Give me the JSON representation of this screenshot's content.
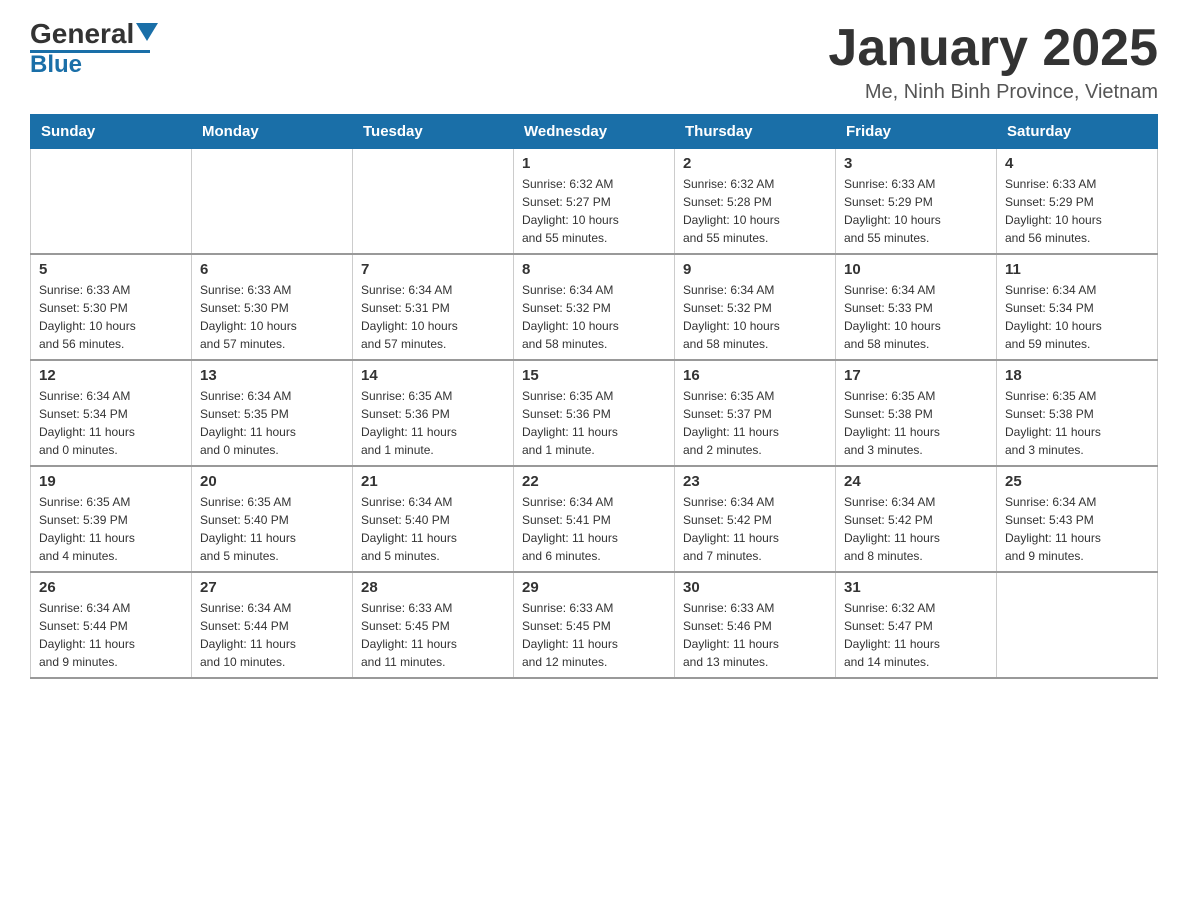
{
  "header": {
    "logo_general": "General",
    "logo_blue": "Blue",
    "title": "January 2025",
    "subtitle": "Me, Ninh Binh Province, Vietnam"
  },
  "days_of_week": [
    "Sunday",
    "Monday",
    "Tuesday",
    "Wednesday",
    "Thursday",
    "Friday",
    "Saturday"
  ],
  "weeks": [
    [
      {
        "day": "",
        "info": ""
      },
      {
        "day": "",
        "info": ""
      },
      {
        "day": "",
        "info": ""
      },
      {
        "day": "1",
        "info": "Sunrise: 6:32 AM\nSunset: 5:27 PM\nDaylight: 10 hours\nand 55 minutes."
      },
      {
        "day": "2",
        "info": "Sunrise: 6:32 AM\nSunset: 5:28 PM\nDaylight: 10 hours\nand 55 minutes."
      },
      {
        "day": "3",
        "info": "Sunrise: 6:33 AM\nSunset: 5:29 PM\nDaylight: 10 hours\nand 55 minutes."
      },
      {
        "day": "4",
        "info": "Sunrise: 6:33 AM\nSunset: 5:29 PM\nDaylight: 10 hours\nand 56 minutes."
      }
    ],
    [
      {
        "day": "5",
        "info": "Sunrise: 6:33 AM\nSunset: 5:30 PM\nDaylight: 10 hours\nand 56 minutes."
      },
      {
        "day": "6",
        "info": "Sunrise: 6:33 AM\nSunset: 5:30 PM\nDaylight: 10 hours\nand 57 minutes."
      },
      {
        "day": "7",
        "info": "Sunrise: 6:34 AM\nSunset: 5:31 PM\nDaylight: 10 hours\nand 57 minutes."
      },
      {
        "day": "8",
        "info": "Sunrise: 6:34 AM\nSunset: 5:32 PM\nDaylight: 10 hours\nand 58 minutes."
      },
      {
        "day": "9",
        "info": "Sunrise: 6:34 AM\nSunset: 5:32 PM\nDaylight: 10 hours\nand 58 minutes."
      },
      {
        "day": "10",
        "info": "Sunrise: 6:34 AM\nSunset: 5:33 PM\nDaylight: 10 hours\nand 58 minutes."
      },
      {
        "day": "11",
        "info": "Sunrise: 6:34 AM\nSunset: 5:34 PM\nDaylight: 10 hours\nand 59 minutes."
      }
    ],
    [
      {
        "day": "12",
        "info": "Sunrise: 6:34 AM\nSunset: 5:34 PM\nDaylight: 11 hours\nand 0 minutes."
      },
      {
        "day": "13",
        "info": "Sunrise: 6:34 AM\nSunset: 5:35 PM\nDaylight: 11 hours\nand 0 minutes."
      },
      {
        "day": "14",
        "info": "Sunrise: 6:35 AM\nSunset: 5:36 PM\nDaylight: 11 hours\nand 1 minute."
      },
      {
        "day": "15",
        "info": "Sunrise: 6:35 AM\nSunset: 5:36 PM\nDaylight: 11 hours\nand 1 minute."
      },
      {
        "day": "16",
        "info": "Sunrise: 6:35 AM\nSunset: 5:37 PM\nDaylight: 11 hours\nand 2 minutes."
      },
      {
        "day": "17",
        "info": "Sunrise: 6:35 AM\nSunset: 5:38 PM\nDaylight: 11 hours\nand 3 minutes."
      },
      {
        "day": "18",
        "info": "Sunrise: 6:35 AM\nSunset: 5:38 PM\nDaylight: 11 hours\nand 3 minutes."
      }
    ],
    [
      {
        "day": "19",
        "info": "Sunrise: 6:35 AM\nSunset: 5:39 PM\nDaylight: 11 hours\nand 4 minutes."
      },
      {
        "day": "20",
        "info": "Sunrise: 6:35 AM\nSunset: 5:40 PM\nDaylight: 11 hours\nand 5 minutes."
      },
      {
        "day": "21",
        "info": "Sunrise: 6:34 AM\nSunset: 5:40 PM\nDaylight: 11 hours\nand 5 minutes."
      },
      {
        "day": "22",
        "info": "Sunrise: 6:34 AM\nSunset: 5:41 PM\nDaylight: 11 hours\nand 6 minutes."
      },
      {
        "day": "23",
        "info": "Sunrise: 6:34 AM\nSunset: 5:42 PM\nDaylight: 11 hours\nand 7 minutes."
      },
      {
        "day": "24",
        "info": "Sunrise: 6:34 AM\nSunset: 5:42 PM\nDaylight: 11 hours\nand 8 minutes."
      },
      {
        "day": "25",
        "info": "Sunrise: 6:34 AM\nSunset: 5:43 PM\nDaylight: 11 hours\nand 9 minutes."
      }
    ],
    [
      {
        "day": "26",
        "info": "Sunrise: 6:34 AM\nSunset: 5:44 PM\nDaylight: 11 hours\nand 9 minutes."
      },
      {
        "day": "27",
        "info": "Sunrise: 6:34 AM\nSunset: 5:44 PM\nDaylight: 11 hours\nand 10 minutes."
      },
      {
        "day": "28",
        "info": "Sunrise: 6:33 AM\nSunset: 5:45 PM\nDaylight: 11 hours\nand 11 minutes."
      },
      {
        "day": "29",
        "info": "Sunrise: 6:33 AM\nSunset: 5:45 PM\nDaylight: 11 hours\nand 12 minutes."
      },
      {
        "day": "30",
        "info": "Sunrise: 6:33 AM\nSunset: 5:46 PM\nDaylight: 11 hours\nand 13 minutes."
      },
      {
        "day": "31",
        "info": "Sunrise: 6:32 AM\nSunset: 5:47 PM\nDaylight: 11 hours\nand 14 minutes."
      },
      {
        "day": "",
        "info": ""
      }
    ]
  ]
}
